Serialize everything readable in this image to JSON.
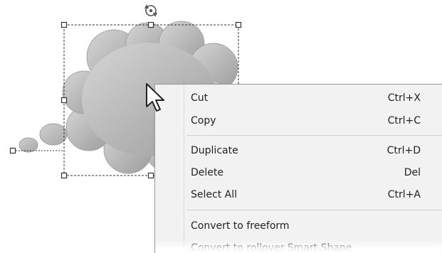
{
  "context_menu": {
    "items": [
      {
        "label": "Cut",
        "shortcut": "Ctrl+X"
      },
      {
        "label": "Copy",
        "shortcut": "Ctrl+C"
      },
      {
        "label": "Duplicate",
        "shortcut": "Ctrl+D"
      },
      {
        "label": "Delete",
        "shortcut": "Del"
      },
      {
        "label": "Select All",
        "shortcut": "Ctrl+A"
      },
      {
        "label": "Convert to freeform",
        "shortcut": ""
      },
      {
        "label": "Convert to rollover Smart Shape",
        "shortcut": ""
      }
    ]
  },
  "colors": {
    "menu_bg": "#f2f2f2",
    "shape_fill_light": "#d7d7d7",
    "shape_fill_dark": "#9a9a9a"
  },
  "icons": {
    "rotate": "rotate-handle-icon",
    "cursor": "mouse-pointer-icon"
  }
}
